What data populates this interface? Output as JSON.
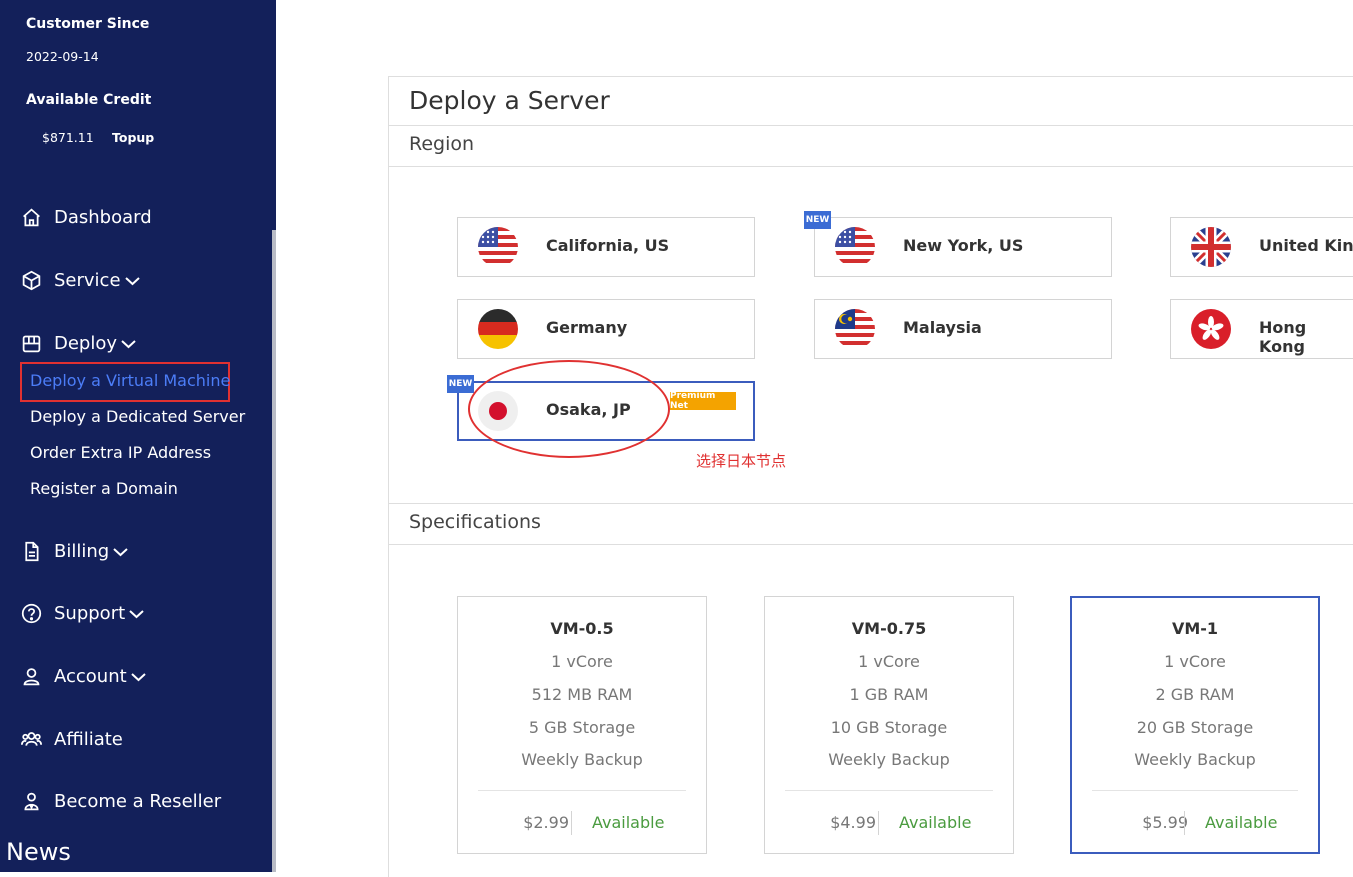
{
  "sidebar": {
    "customer_since_label": "Customer Since",
    "customer_since_date": "2022-09-14",
    "available_credit_label": "Available Credit",
    "credit_amount": "$871.11",
    "topup_label": "Topup",
    "nav": {
      "dashboard": "Dashboard",
      "service": "Service",
      "deploy": "Deploy",
      "billing": "Billing",
      "support": "Support",
      "account": "Account",
      "affiliate": "Affiliate",
      "reseller": "Become a Reseller"
    },
    "deploy_sub": [
      "Deploy a Virtual Machine",
      "Deploy a Dedicated Server",
      "Order Extra IP Address",
      "Register a Domain"
    ],
    "news": "News"
  },
  "main": {
    "title": "Deploy a Server",
    "region_title": "Region",
    "spec_title": "Specifications",
    "regions": [
      {
        "name": "California, US",
        "flag": "us-flag-icon"
      },
      {
        "name": "New York, US",
        "flag": "us-flag-icon",
        "badge": "NEW"
      },
      {
        "name": "United Kingdom",
        "flag": "uk-flag-icon"
      },
      {
        "name": "Germany",
        "flag": "de-flag-icon"
      },
      {
        "name": "Malaysia",
        "flag": "my-flag-icon"
      },
      {
        "name": "Hong Kong",
        "flag": "hk-flag-icon"
      },
      {
        "name": "Osaka, JP",
        "flag": "jp-flag-icon",
        "badge": "NEW",
        "tag": "Premium Net",
        "selected": true
      }
    ],
    "annotation": "选择日本节点",
    "specs": [
      {
        "name": "VM-0.5",
        "cpu": "1 vCore",
        "ram": "512 MB RAM",
        "storage": "5 GB Storage",
        "backup": "Weekly Backup",
        "price": "$2.99",
        "status": "Available"
      },
      {
        "name": "VM-0.75",
        "cpu": "1 vCore",
        "ram": "1 GB RAM",
        "storage": "10 GB Storage",
        "backup": "Weekly Backup",
        "price": "$4.99",
        "status": "Available"
      },
      {
        "name": "VM-1",
        "cpu": "1 vCore",
        "ram": "2 GB RAM",
        "storage": "20 GB Storage",
        "backup": "Weekly Backup",
        "price": "$5.99",
        "status": "Available",
        "selected": true
      }
    ]
  },
  "colors": {
    "sidebar_bg": "#13205a",
    "accent": "#3b5cbd",
    "active_link": "#4c7df7",
    "annotation": "#e03131",
    "badge_new": "#3b6cd4",
    "badge_premium": "#f4a300",
    "available": "#4a9b3f"
  }
}
